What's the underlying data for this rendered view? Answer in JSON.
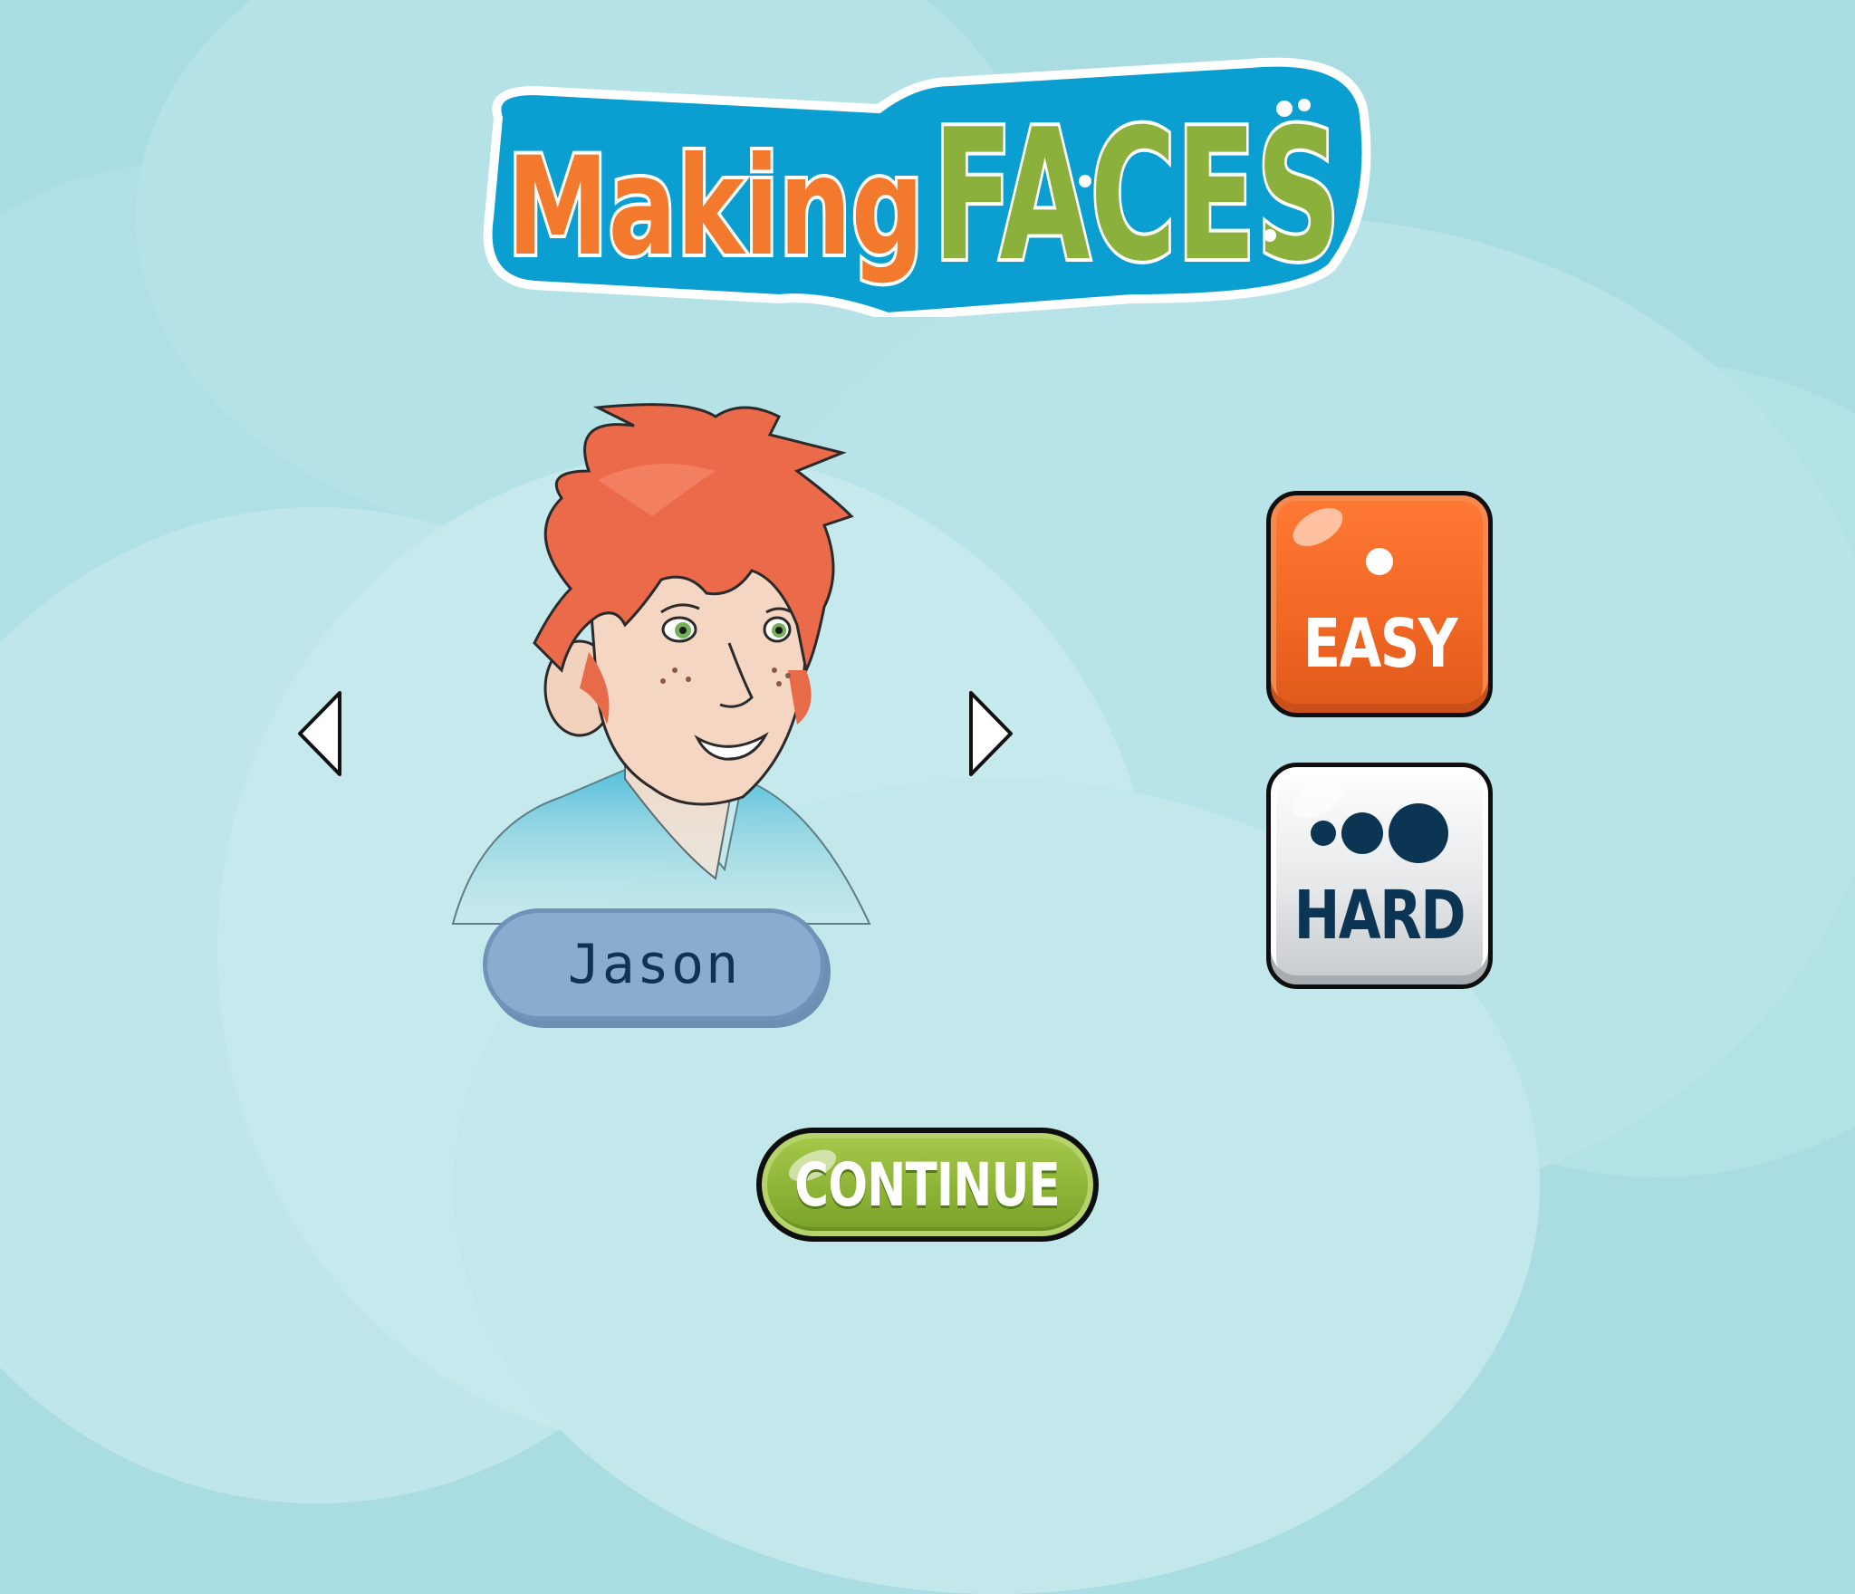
{
  "logo": {
    "word1": "Making",
    "word2": "FACES"
  },
  "character": {
    "name": "Jason"
  },
  "navigation": {
    "prev_icon": "triangle-left-icon",
    "next_icon": "triangle-right-icon"
  },
  "difficulty": {
    "easy": {
      "label": "EASY",
      "dots": 1,
      "color": "#f06622"
    },
    "hard": {
      "label": "HARD",
      "dots": 3,
      "color": "#e6e8ea"
    }
  },
  "continue": {
    "label": "CONTINUE",
    "color": "#8db336"
  }
}
